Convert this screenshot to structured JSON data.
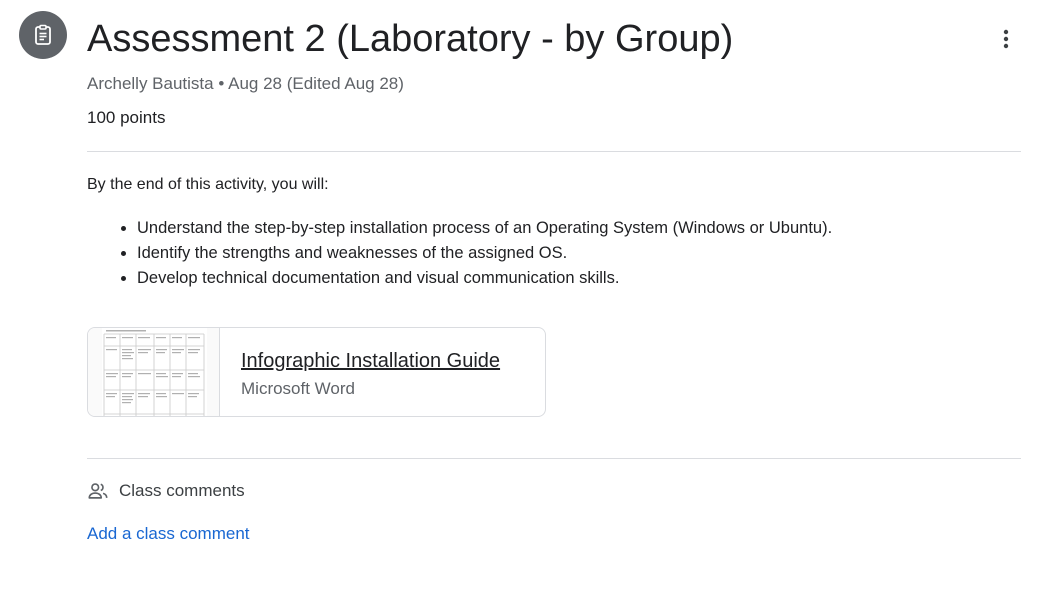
{
  "assignment": {
    "icon": "assignment-icon",
    "title": "Assessment 2 (Laboratory - by Group)",
    "author": "Archelly Bautista",
    "separator": "•",
    "date": "Aug 28 (Edited Aug 28)",
    "points": "100 points"
  },
  "menu": {
    "icon": "more-vert-icon"
  },
  "description": {
    "intro": "By the end of this activity, you will:",
    "objectives": [
      "Understand the step-by-step installation process of an Operating System (Windows or Ubuntu).",
      "Identify the strengths and weaknesses of the assigned OS.",
      "Develop technical documentation and visual communication skills."
    ]
  },
  "attachment": {
    "title": "Infographic Installation Guide",
    "type": "Microsoft Word",
    "thumbnail_icon": "document-thumbnail"
  },
  "comments": {
    "icon": "people-icon",
    "heading": "Class comments",
    "add_label": "Add a class comment"
  },
  "colors": {
    "link": "#1967d2",
    "icon_bg": "#5f6368",
    "divider": "#dadce0",
    "title": "#202124"
  }
}
